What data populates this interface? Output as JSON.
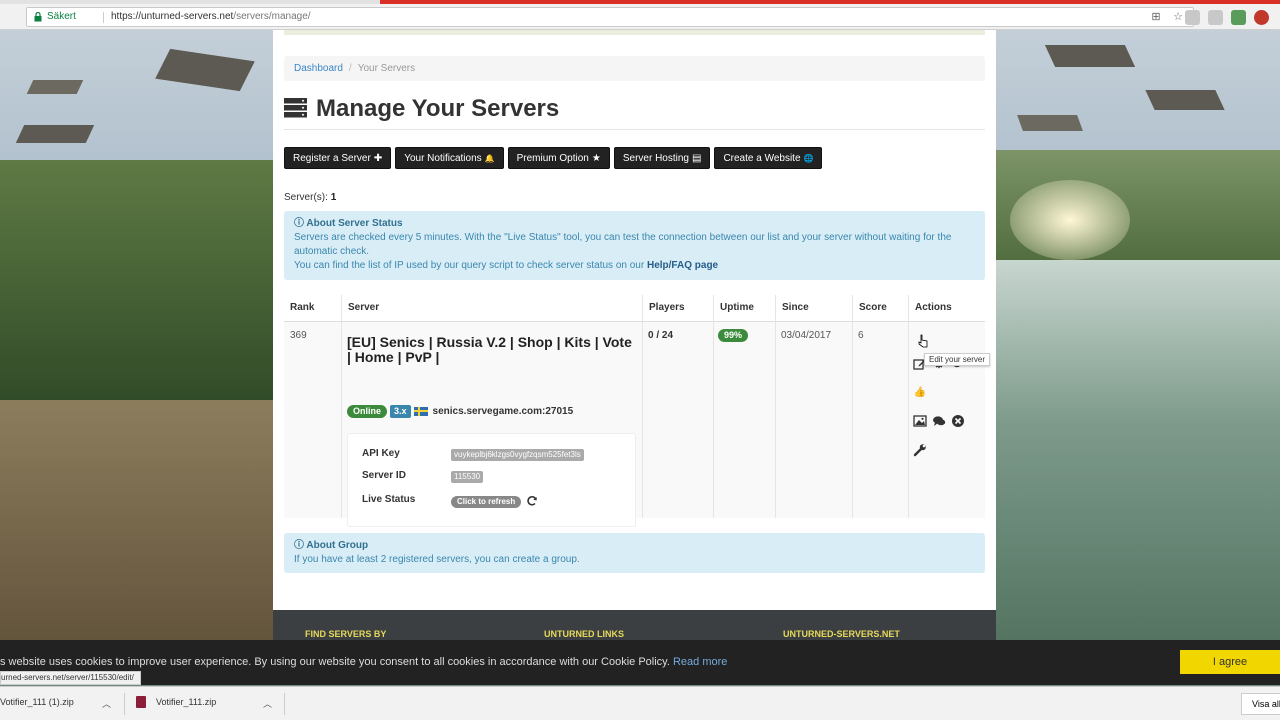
{
  "browser": {
    "secure_label": "Säkert",
    "url_host": "https://unturned-servers.net",
    "url_path": "/servers/manage/"
  },
  "breadcrumb": {
    "home": "Dashboard",
    "separator": "/",
    "current": "Your Servers"
  },
  "page_title": "Manage Your Servers",
  "toolbar": {
    "buttons": [
      {
        "label": "Register a Server",
        "glyph": "✚"
      },
      {
        "label": "Your Notifications",
        "glyph": "🔔"
      },
      {
        "label": "Premium Option",
        "glyph": "★"
      },
      {
        "label": "Server Hosting",
        "glyph": "▤"
      },
      {
        "label": "Create a Website",
        "glyph": "🌐"
      }
    ]
  },
  "server_count": {
    "label": "Server(s):",
    "value": "1"
  },
  "status_alert": {
    "title": "About Server Status",
    "line1": "Servers are checked every 5 minutes. With the \"Live Status\" tool, you can test the connection between our list and your server without waiting for the automatic check.",
    "line2": "You can find the list of IP used by our query script to check server status on our",
    "link": "Help/FAQ page"
  },
  "table": {
    "headers": [
      "Rank",
      "Server",
      "Players",
      "Uptime",
      "Since",
      "Score",
      "Actions"
    ],
    "row": {
      "rank": "369",
      "name": "[EU] Senics | Russia V.2 | Shop | Kits | Vote | Home | PvP |",
      "status": "Online",
      "version": "3.x",
      "address": "senics.servegame.com:27015",
      "players": "0 / 24",
      "uptime": "99%",
      "since": "03/04/2017",
      "score": "6",
      "details": {
        "api_key_label": "API Key",
        "api_key_value": "vuykeplbj6klzgs0vygfzqsm525fet3ls",
        "server_id_label": "Server ID",
        "server_id_value": "115530",
        "live_status_label": "Live Status",
        "refresh_label": "Click to refresh"
      }
    }
  },
  "tooltip": "Edit your server",
  "group_alert": {
    "title": "About Group",
    "text": "If you have at least 2 registered servers, you can create a group."
  },
  "footer": {
    "col1": "FIND SERVERS BY",
    "col2": "UNTURNED LINKS",
    "col3": "UNTURNED-SERVERS.NET"
  },
  "cookie": {
    "message": "s website uses cookies to improve user experience. By using our website you consent to all cookies in accordance with our Cookie Policy.",
    "read_more": "Read more",
    "agree": "I agree"
  },
  "status_url": "urned-servers.net/server/115530/edit/",
  "downloads": {
    "items": [
      "Votifier_111 (1).zip",
      "Votifier_111.zip"
    ],
    "show_all": "Visa all"
  }
}
